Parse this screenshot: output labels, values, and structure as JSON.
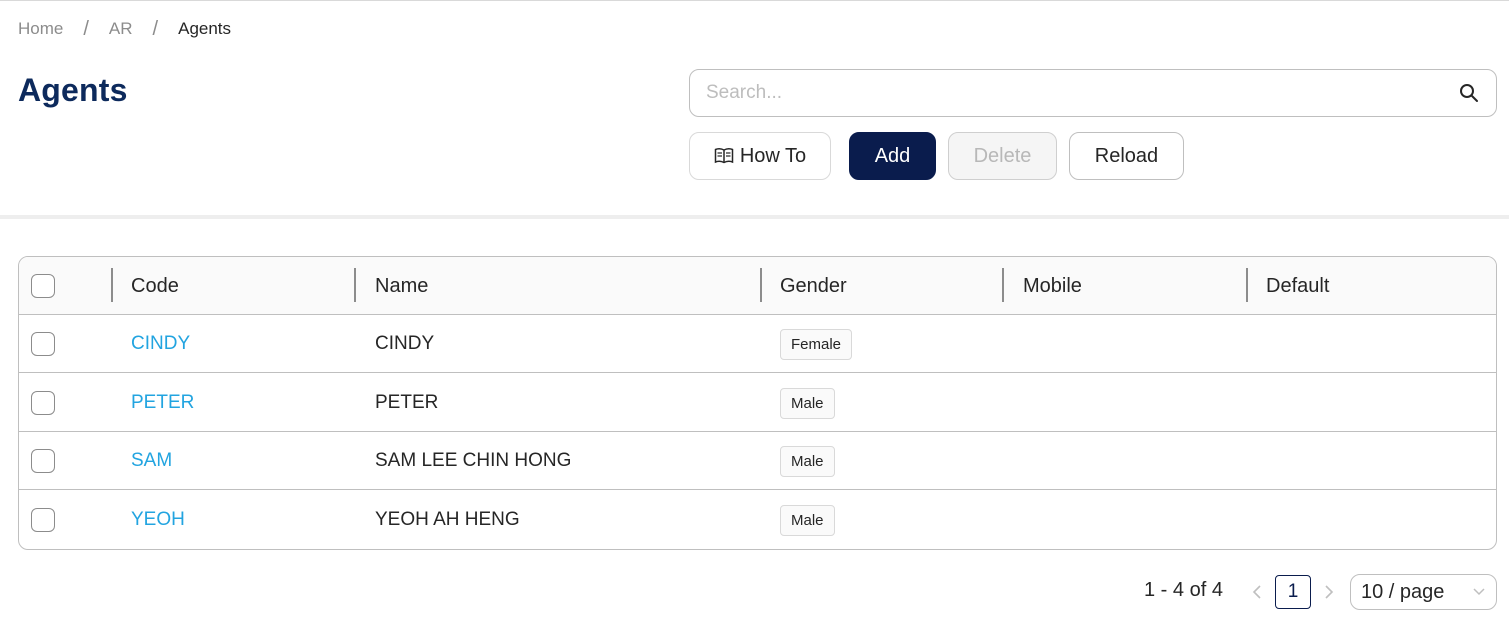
{
  "breadcrumb": {
    "items": [
      "Home",
      "AR",
      "Agents"
    ],
    "separator": "/"
  },
  "page": {
    "title": "Agents"
  },
  "search": {
    "placeholder": "Search..."
  },
  "toolbar": {
    "howto_label": "How To",
    "add_label": "Add",
    "delete_label": "Delete",
    "reload_label": "Reload"
  },
  "table": {
    "columns": [
      "Code",
      "Name",
      "Gender",
      "Mobile",
      "Default"
    ],
    "rows": [
      {
        "code": "CINDY",
        "name": "CINDY",
        "gender": "Female",
        "mobile": "",
        "default": ""
      },
      {
        "code": "PETER",
        "name": "PETER",
        "gender": "Male",
        "mobile": "",
        "default": ""
      },
      {
        "code": "SAM",
        "name": "SAM LEE CHIN HONG",
        "gender": "Male",
        "mobile": "",
        "default": ""
      },
      {
        "code": "YEOH",
        "name": "YEOH AH HENG",
        "gender": "Male",
        "mobile": "",
        "default": ""
      }
    ]
  },
  "pagination": {
    "total_text": "1 - 4 of 4",
    "current_page": "1",
    "page_size_label": "10 / page"
  },
  "colors": {
    "primary": "#0a1c4d",
    "title": "#0d2a5c",
    "link": "#22a4e0"
  },
  "icons": {
    "search": "search-icon",
    "howto": "book-icon",
    "prev": "chevron-left-icon",
    "next": "chevron-right-icon",
    "page_size": "chevron-down-icon"
  }
}
